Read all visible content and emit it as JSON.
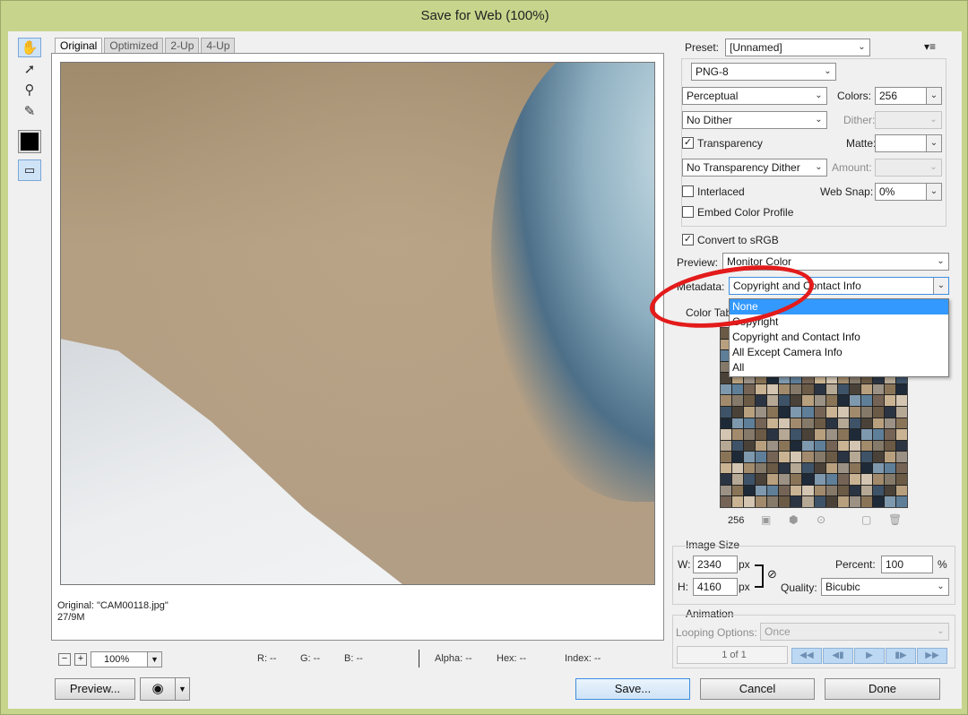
{
  "window": {
    "title": "Save for Web (100%)"
  },
  "toolbox": {
    "tools": [
      {
        "name": "hand-tool",
        "glyph": "✋"
      },
      {
        "name": "slice-select-tool",
        "glyph": "➚"
      },
      {
        "name": "zoom-tool",
        "glyph": "🔍"
      },
      {
        "name": "eyedropper-tool",
        "glyph": "✎"
      }
    ],
    "eyedropper_color": "#000000"
  },
  "preview": {
    "tabs": [
      "Original",
      "Optimized",
      "2-Up",
      "4-Up"
    ],
    "active_tab": "Original",
    "caption_line1": "Original: \"CAM00118.jpg\"",
    "caption_line2": "27/9M"
  },
  "status": {
    "zoom": "100%",
    "zoom_out": "−",
    "zoom_in": "+",
    "r": "R: --",
    "g": "G: --",
    "b": "B: --",
    "alpha": "Alpha: --",
    "hex": "Hex: --",
    "index": "Index: --"
  },
  "buttons": {
    "preview": "Preview...",
    "save": "Save...",
    "cancel": "Cancel",
    "done": "Done"
  },
  "settings": {
    "preset_label": "Preset:",
    "preset_value": "[Unnamed]",
    "format": "PNG-8",
    "reduction": "Perceptual",
    "colors_label": "Colors:",
    "colors_value": "256",
    "dither": "No Dither",
    "dither_label": "Dither:",
    "transparency_label": "Transparency",
    "transparency_checked": true,
    "matte_label": "Matte:",
    "transparency_dither": "No Transparency Dither",
    "amount_label": "Amount:",
    "interlaced_label": "Interlaced",
    "interlaced_checked": false,
    "websnap_label": "Web Snap:",
    "websnap_value": "0%",
    "embed_profile_label": "Embed Color Profile",
    "embed_profile_checked": false,
    "convert_srgb_label": "Convert to sRGB",
    "convert_srgb_checked": true,
    "preview_label": "Preview:",
    "preview_value": "Monitor Color",
    "metadata_label": "Metadata:",
    "metadata_value": "Copyright and Contact Info",
    "metadata_options": [
      "None",
      "Copyright",
      "Copyright and Contact Info",
      "All Except Camera Info",
      "All"
    ],
    "metadata_highlighted": "None",
    "color_table_label": "Color Table",
    "color_count": "256"
  },
  "image_size": {
    "title": "Image Size",
    "w_label": "W:",
    "w_value": "2340",
    "h_label": "H:",
    "h_value": "4160",
    "unit": "px",
    "percent_label": "Percent:",
    "percent_value": "100",
    "percent_unit": "%",
    "quality_label": "Quality:",
    "quality_value": "Bicubic"
  },
  "animation": {
    "title": "Animation",
    "looping_label": "Looping Options:",
    "looping_value": "Once",
    "frame_counter": "1 of 1"
  },
  "colors": {
    "accent": "#3399ff",
    "annotation": "#e31b1b",
    "window_frame": "#c7d58c"
  },
  "palette": [
    "#6b5a45",
    "#8a7458",
    "#a28a6c",
    "#b8a07f",
    "#c9b393",
    "#3e5368",
    "#5f7f99",
    "#2b3442",
    "#1e2a38",
    "#857969",
    "#9b9184",
    "#d3c5b1",
    "#4a4238",
    "#756455",
    "#b5a894",
    "#7e98ad"
  ]
}
